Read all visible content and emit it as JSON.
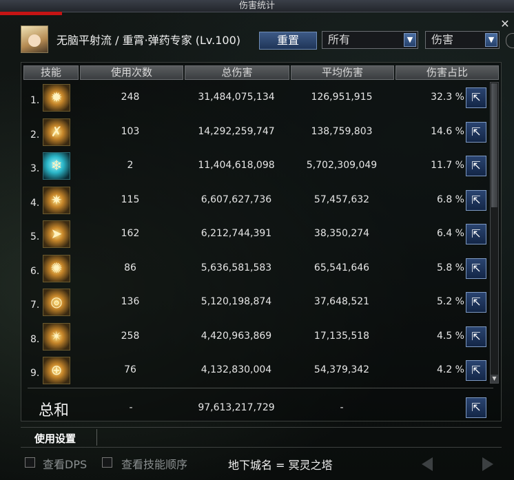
{
  "window": {
    "title": "伤害统计"
  },
  "character": {
    "name": "无脑平射流 / 重霄·弹药专家 (Lv.100)"
  },
  "controls": {
    "reset_label": "重置",
    "filter_selected": "所有",
    "mode_selected": "伤害"
  },
  "table": {
    "headers": [
      "技能",
      "使用次数",
      "总伤害",
      "平均伤害",
      "伤害占比"
    ],
    "rows": [
      {
        "rank": "1.",
        "uses": "248",
        "total": "31,484,075,134",
        "avg": "126,951,915",
        "pct": "32.3 %",
        "icon": "fire-ring-skill-icon"
      },
      {
        "rank": "2.",
        "uses": "103",
        "total": "14,292,259,747",
        "avg": "138,759,803",
        "pct": "14.6 %",
        "icon": "crossed-shot-skill-icon"
      },
      {
        "rank": "3.",
        "uses": "2",
        "total": "11,404,618,098",
        "avg": "5,702,309,049",
        "pct": "11.7 %",
        "icon": "frost-burst-skill-icon"
      },
      {
        "rank": "4.",
        "uses": "115",
        "total": "6,607,627,736",
        "avg": "57,457,632",
        "pct": "6.8 %",
        "icon": "spark-blast-skill-icon"
      },
      {
        "rank": "5.",
        "uses": "162",
        "total": "6,212,744,391",
        "avg": "38,350,274",
        "pct": "6.4 %",
        "icon": "bullet-trail-skill-icon"
      },
      {
        "rank": "6.",
        "uses": "86",
        "total": "5,636,581,583",
        "avg": "65,541,646",
        "pct": "5.8 %",
        "icon": "starburst-skill-icon"
      },
      {
        "rank": "7.",
        "uses": "136",
        "total": "5,120,198,874",
        "avg": "37,648,521",
        "pct": "5.2 %",
        "icon": "target-lock-skill-icon"
      },
      {
        "rank": "8.",
        "uses": "258",
        "total": "4,420,963,869",
        "avg": "17,135,518",
        "pct": "4.5 %",
        "icon": "spread-shot-skill-icon"
      },
      {
        "rank": "9.",
        "uses": "76",
        "total": "4,132,830,004",
        "avg": "54,379,342",
        "pct": "4.2 %",
        "icon": "crosshair-grenade-skill-icon"
      }
    ],
    "total": {
      "label": "总和",
      "uses": "-",
      "total": "97,613,217,729",
      "avg": "-"
    }
  },
  "settings": {
    "label": "使用设置"
  },
  "footer": {
    "view_dps_label": "查看DPS",
    "view_order_label": "查看技能顺序",
    "dungeon_label": "地下城名 = 冥灵之塔"
  },
  "overlay_text": {
    "player_name_tag": "无脑平射流"
  }
}
